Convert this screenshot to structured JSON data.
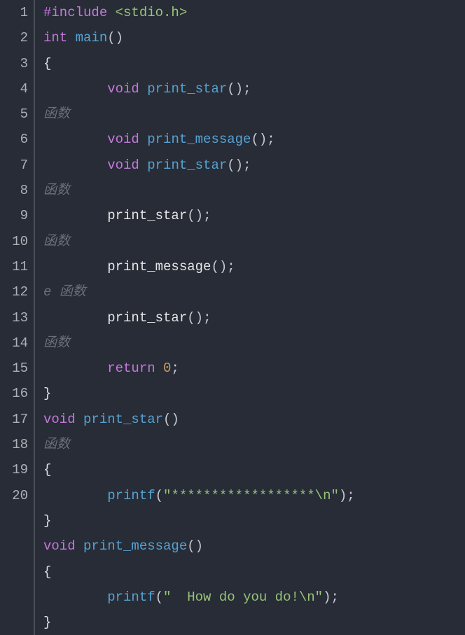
{
  "gutter": [
    "1",
    "2",
    "3",
    "4",
    "5",
    "6",
    "7",
    "8",
    "9",
    "10",
    "11",
    "12",
    "13",
    "14",
    "15",
    "16",
    "17",
    "18",
    "19",
    "20",
    "",
    "",
    "",
    "",
    ""
  ],
  "lines": {
    "l1_pre": "#include",
    "l1_inc": " <stdio.h>",
    "l2_kw": "int",
    "l2_sp": " ",
    "l2_fn": "main",
    "l2_par": "()",
    "l3_br": "{",
    "l4_ind": "        ",
    "l4_kw": "void",
    "l4_sp": " ",
    "l4_fn": "print_star",
    "l4_par": "()",
    "l4_sc": ";",
    "l5_ghost": "函数",
    "l6_ind": "        ",
    "l6_kw": "void",
    "l6_sp": " ",
    "l6_fn": "print_message",
    "l6_par": "()",
    "l6_sc": ";",
    "l7_ind": "        ",
    "l7_kw": "void",
    "l7_sp": " ",
    "l7_fn": "print_star",
    "l7_par": "()",
    "l7_sc": ";",
    "l8_ghost": "函数",
    "l9_ind": "        ",
    "l9_fn": "print_star",
    "l9_par": "()",
    "l9_sc": ";",
    "l10_ghost": "函数",
    "l11_ind": "        ",
    "l11_fn": "print_message",
    "l11_par": "()",
    "l11_sc": ";",
    "l12_ghost": "e 函数",
    "l13_ind": "        ",
    "l13_fn": "print_star",
    "l13_par": "()",
    "l13_sc": ";",
    "l14_ghost": "函数",
    "l15_ind": "        ",
    "l15_kw": "return",
    "l15_sp": " ",
    "l15_num": "0",
    "l15_sc": ";",
    "l16_br": "}",
    "l17_kw": "void",
    "l17_sp": " ",
    "l17_fn": "print_star",
    "l17_par": "()",
    "l18_ghost": "函数",
    "l19_br": "{",
    "l20_ind": "        ",
    "l20_fn": "printf",
    "l20_op": "(",
    "l20_str": "\"******************\\n\"",
    "l20_cp": ")",
    "l20_sc": ";",
    "l21_br": "}",
    "l22_kw": "void",
    "l22_sp": " ",
    "l22_fn": "print_message",
    "l22_par": "()",
    "l23_br": "{",
    "l24_ind": "        ",
    "l24_fn": "printf",
    "l24_op": "(",
    "l24_str": "\"  How do you do!\\n\"",
    "l24_cp": ")",
    "l24_sc": ";",
    "l25_br": "}"
  }
}
